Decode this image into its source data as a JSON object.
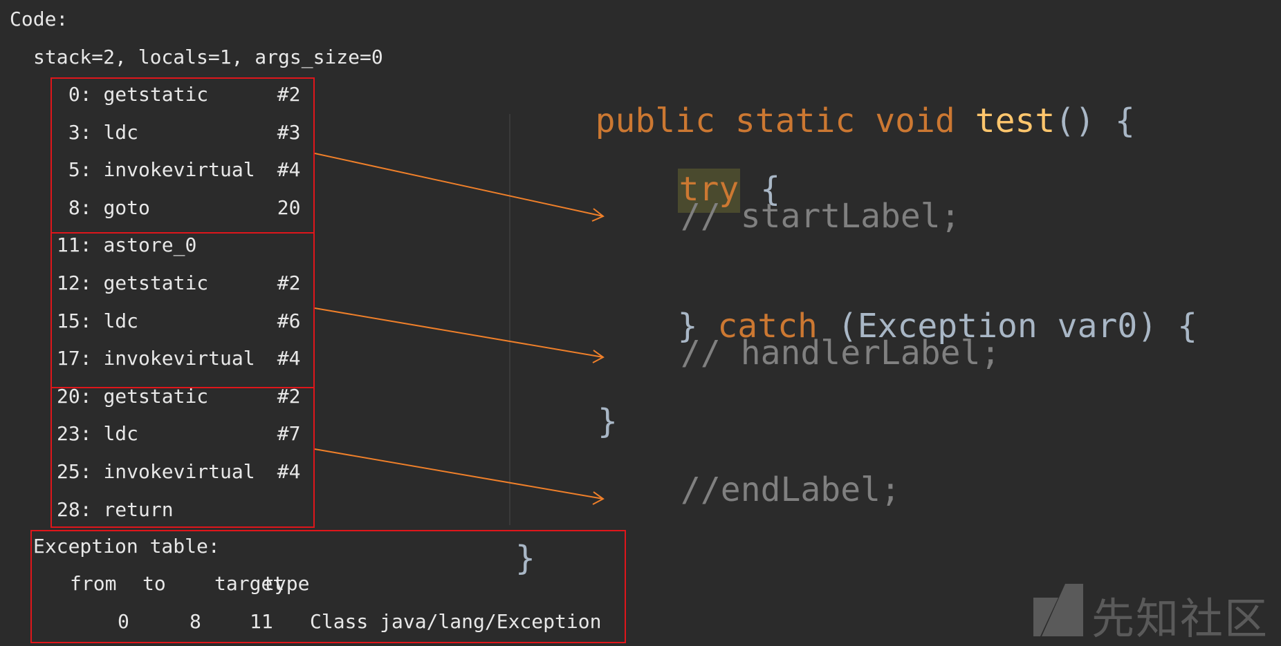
{
  "bytecode": {
    "header": "Code:",
    "stack_info": "stack=2, locals=1, args_size=0",
    "instructions": [
      {
        "offset": " 0:",
        "op": "getstatic",
        "arg": "#2"
      },
      {
        "offset": " 3:",
        "op": "ldc",
        "arg": "#3"
      },
      {
        "offset": " 5:",
        "op": "invokevirtual",
        "arg": "#4"
      },
      {
        "offset": " 8:",
        "op": "goto",
        "arg": "20"
      },
      {
        "offset": "11:",
        "op": "astore_0",
        "arg": ""
      },
      {
        "offset": "12:",
        "op": "getstatic",
        "arg": "#2"
      },
      {
        "offset": "15:",
        "op": "ldc",
        "arg": "#6"
      },
      {
        "offset": "17:",
        "op": "invokevirtual",
        "arg": "#4"
      },
      {
        "offset": "20:",
        "op": "getstatic",
        "arg": "#2"
      },
      {
        "offset": "23:",
        "op": "ldc",
        "arg": "#7"
      },
      {
        "offset": "25:",
        "op": "invokevirtual",
        "arg": "#4"
      },
      {
        "offset": "28:",
        "op": "return",
        "arg": ""
      }
    ],
    "exception_table": {
      "title": "Exception table:",
      "columns": [
        "from",
        "to",
        "target",
        "type"
      ],
      "rows": [
        {
          "from": "0",
          "to": "8",
          "target": "11",
          "type": "Class java/lang/Exception"
        }
      ]
    }
  },
  "source": {
    "kw_public": "public",
    "kw_static": "static",
    "kw_void": "void",
    "method_name": "test",
    "signature_rest": "() {",
    "kw_try": "try",
    "try_brace": " {",
    "comment_start": "// startLabel;",
    "catch_close": "} ",
    "kw_catch": "catch",
    "catch_args": " (Exception var0) {",
    "comment_handler": "// handlerLabel;",
    "close_brace": "}",
    "comment_end": "//endLabel;",
    "final_brace": "}"
  },
  "watermark": {
    "text": "先知社区"
  },
  "colors": {
    "background": "#2b2b2b",
    "box_border": "#e0161b",
    "arrow": "#f0802a",
    "keyword": "#cc7832",
    "method": "#ffc66d",
    "comment": "#808080",
    "plain": "#a9b7c6"
  }
}
